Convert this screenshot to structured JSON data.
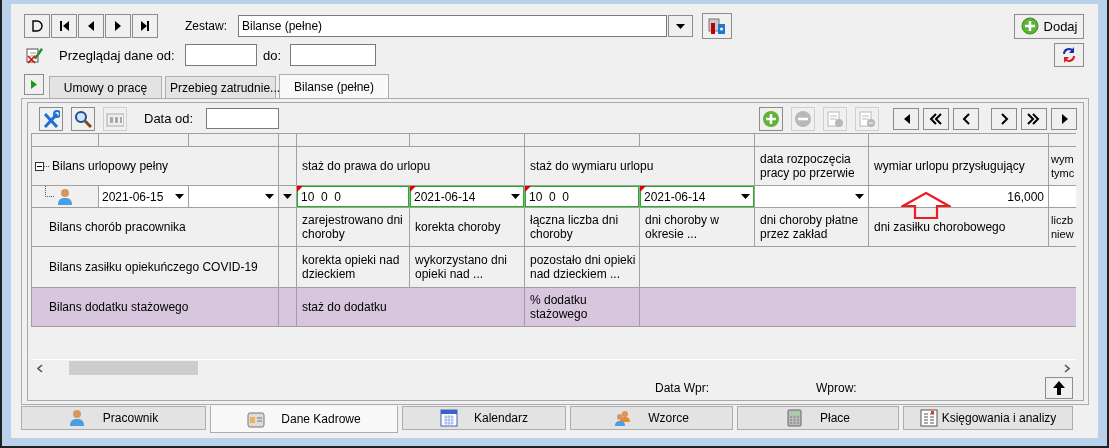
{
  "top_bar": {
    "set_label": "Zestaw:",
    "set_value": "Bilanse (pełne)",
    "add_button": "Dodaj"
  },
  "date_filter": {
    "from_label": "Przeglądaj dane od:",
    "to_label": "do:"
  },
  "tabs": [
    {
      "label": "Umowy o pracę",
      "selected": false
    },
    {
      "label": "Przebieg zatrudnie...",
      "selected": false
    },
    {
      "label": "Bilanse (pełne)",
      "selected": true
    }
  ],
  "grid_toolbar": {
    "date_label": "Data od:",
    "tools": [
      {
        "kind": "settings",
        "disabled": false
      },
      {
        "kind": "search",
        "disabled": false
      },
      {
        "kind": "counter",
        "disabled": true
      }
    ],
    "row_buttons": [
      {
        "kind": "add",
        "disabled": false
      },
      {
        "kind": "remove",
        "disabled": true
      },
      {
        "kind": "doc_add",
        "disabled": true
      },
      {
        "kind": "doc_remove",
        "disabled": true
      }
    ]
  },
  "grid": {
    "rows": [
      {
        "kind": "group",
        "label": "Bilans urlopowy pełny",
        "expanded": true,
        "selected": false,
        "cells": [
          {
            "text": "staż do prawa do urlopu"
          },
          {
            "text": ""
          },
          {
            "text": "staż do wymiaru urlopu"
          },
          {
            "text": ""
          },
          {
            "text": "data rozpoczęcia pracy po przerwie"
          },
          {
            "text": "wymiar urlopu przysługujący"
          },
          {
            "text": "wym tymc"
          }
        ]
      },
      {
        "kind": "entry",
        "date": "2021-06-15",
        "cells": [
          {
            "kind": "text",
            "value": "10  0  0",
            "modified": true
          },
          {
            "kind": "combo",
            "value": "2021-06-14",
            "modified": true
          },
          {
            "kind": "text",
            "value": "10  0  0",
            "modified": true
          },
          {
            "kind": "combo",
            "value": "2021-06-14",
            "modified": true
          },
          {
            "kind": "combo",
            "modified": false
          },
          {
            "kind": "number",
            "value": "16,000",
            "modified": false
          },
          {
            "kind": "text",
            "modified": false
          }
        ]
      },
      {
        "kind": "group",
        "label": "Bilans chorób pracownika",
        "selected": false,
        "cells": [
          {
            "text": "zarejestrowano dni choroby"
          },
          {
            "text": "korekta choroby"
          },
          {
            "text": "łączna liczba dni choroby"
          },
          {
            "text": "dni choroby w okresie ..."
          },
          {
            "text": "dni choroby płatne przez zakład"
          },
          {
            "text": "dni zasiłku chorobowego"
          },
          {
            "text": "liczb niew"
          }
        ]
      },
      {
        "kind": "group",
        "label": "Bilans zasiłku opiekuńczego COVID-19",
        "selected": false,
        "cells": [
          {
            "text": "korekta opieki nad dzieckiem"
          },
          {
            "text": "wykorzystano dni opieki nad ..."
          },
          {
            "text": "pozostało dni opieki nad dzieckiem ..."
          }
        ]
      },
      {
        "kind": "group",
        "label": "Bilans dodatku stażowego",
        "selected": true,
        "cells": [
          {
            "text": "staż do dodatku"
          },
          {
            "text": ""
          },
          {
            "text": "% dodatku stażowego"
          }
        ]
      }
    ]
  },
  "footer": {
    "entry_date_label": "Data Wpr:",
    "entered_by_label": "Wprow:"
  },
  "bottom_tabs": [
    {
      "label": "Pracownik",
      "selected": false
    },
    {
      "label": "Dane Kadrowe",
      "selected": true
    },
    {
      "label": "Kalendarz",
      "selected": false
    },
    {
      "label": "Wzorce",
      "selected": false
    },
    {
      "label": "Płace",
      "selected": false
    },
    {
      "label": "Księgowania i analizy",
      "selected": false
    }
  ]
}
